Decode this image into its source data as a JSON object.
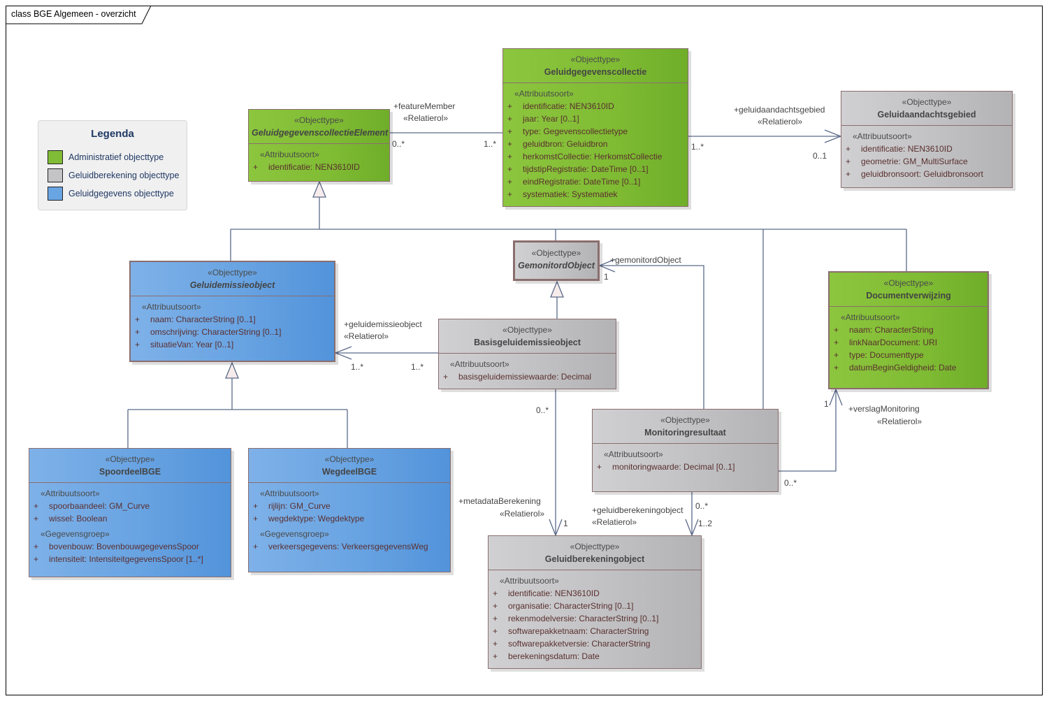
{
  "frame": {
    "title": "class BGE Algemeen - overzicht"
  },
  "colors": {
    "administratief": "#80bc35",
    "geluidberekening": "#c4c4c6",
    "geluidgegevens": "#6aa5e3",
    "connector": "#5b6a8a",
    "legend_text": "#1f3864"
  },
  "legend": {
    "title": "Legenda",
    "items": [
      {
        "label": "Administratief objecttype",
        "color": "#80bc35"
      },
      {
        "label": "Geluidberekening objecttype",
        "color": "#c4c4c6"
      },
      {
        "label": "Geluidgegevens objecttype",
        "color": "#6aa5e3"
      }
    ]
  },
  "classes": {
    "geluidgegevenscollectie": {
      "stereotype": "«Objecttype»",
      "name": "Geluidgegevenscollectie",
      "sections": [
        {
          "stereotype": "«Attribuutsoort»",
          "attributes": [
            "identificatie: NEN3610ID",
            "jaar: Year [0..1]",
            "type: Gegevenscollectietype",
            "geluidbron: Geluidbron",
            "herkomstCollectie: HerkomstCollectie",
            "tijdstipRegistratie: DateTime [0..1]",
            "eindRegistratie: DateTime [0..1]",
            "systematiek: Systematiek"
          ]
        }
      ]
    },
    "geluidgegevenscollectieElement": {
      "stereotype": "«Objecttype»",
      "name": "GeluidgegevenscollectieElement",
      "sections": [
        {
          "stereotype": "«Attribuutsoort»",
          "attributes": [
            "identificatie: NEN3610ID"
          ]
        }
      ]
    },
    "geluidaandachtsgebied": {
      "stereotype": "«Objecttype»",
      "name": "Geluidaandachtsgebied",
      "sections": [
        {
          "stereotype": "«Attribuutsoort»",
          "attributes": [
            "identificatie: NEN3610ID",
            "geometrie: GM_MultiSurface",
            "geluidbronsoort: Geluidbronsoort"
          ]
        }
      ]
    },
    "geluidemissieobject": {
      "stereotype": "«Objecttype»",
      "name": "Geluidemissieobject",
      "sections": [
        {
          "stereotype": "«Attribuutsoort»",
          "attributes": [
            "naam: CharacterString [0..1]",
            "omschrijving: CharacterString [0..1]",
            "situatieVan: Year [0..1]"
          ]
        }
      ]
    },
    "gemonitordObject": {
      "stereotype": "«Objecttype»",
      "name": "GemonitordObject"
    },
    "basisgeluidemissieobject": {
      "stereotype": "«Objecttype»",
      "name": "Basisgeluidemissieobject",
      "sections": [
        {
          "stereotype": "«Attribuutsoort»",
          "attributes": [
            "basisgeluidemissiewaarde: Decimal"
          ]
        }
      ]
    },
    "documentverwijzing": {
      "stereotype": "«Objecttype»",
      "name": "Documentverwijzing",
      "sections": [
        {
          "stereotype": "«Attribuutsoort»",
          "attributes": [
            "naam: CharacterString",
            "linkNaarDocument: URI",
            "type: Documenttype",
            "datumBeginGeldigheid: Date"
          ]
        }
      ]
    },
    "monitoringresultaat": {
      "stereotype": "«Objecttype»",
      "name": "Monitoringresultaat",
      "sections": [
        {
          "stereotype": "«Attribuutsoort»",
          "attributes": [
            "monitoringwaarde: Decimal [0..1]"
          ]
        }
      ]
    },
    "spoordeelBGE": {
      "stereotype": "«Objecttype»",
      "name": "SpoordeelBGE",
      "sections": [
        {
          "stereotype": "«Attribuutsoort»",
          "attributes": [
            "spoorbaandeel: GM_Curve",
            "wissel: Boolean"
          ]
        },
        {
          "stereotype": "«Gegevensgroep»",
          "attributes": [
            "bovenbouw: BovenbouwgegevensSpoor",
            "intensiteit: IntensiteitgegevensSpoor [1..*]"
          ]
        }
      ]
    },
    "wegdeelBGE": {
      "stereotype": "«Objecttype»",
      "name": "WegdeelBGE",
      "sections": [
        {
          "stereotype": "«Attribuutsoort»",
          "attributes": [
            "rijlijn: GM_Curve",
            "wegdektype: Wegdektype"
          ]
        },
        {
          "stereotype": "«Gegevensgroep»",
          "attributes": [
            "verkeersgegevens: VerkeersgegevensWeg"
          ]
        }
      ]
    },
    "geluidberekeningobject": {
      "stereotype": "«Objecttype»",
      "name": "Geluidberekeningobject",
      "sections": [
        {
          "stereotype": "«Attribuutsoort»",
          "attributes": [
            "identificatie: NEN3610ID",
            "organisatie: CharacterString [0..1]",
            "rekenmodelversie: CharacterString [0..1]",
            "softwarepakketnaam: CharacterString",
            "softwarepakketversie: CharacterString",
            "berekeningsdatum: Date"
          ]
        }
      ]
    }
  },
  "visibility_symbol": "+",
  "associations": {
    "featureMember": {
      "role": "+featureMember",
      "stereotype": "«Relatierol»",
      "source_mult": "0..*",
      "target_mult": "1..*"
    },
    "geluidaandachtsgebied": {
      "role": "+geluidaandachtsgebied",
      "stereotype": "«Relatierol»",
      "source_mult": "1..*",
      "target_mult": "0..1"
    },
    "geluidemissieobject": {
      "role": "+geluidemissieobject",
      "stereotype": "«Relatierol»",
      "source_mult": "1..*",
      "target_mult": "1..*"
    },
    "gemonitordObject": {
      "role": "+gemonitordObject",
      "target_mult": "1"
    },
    "verslagMonitoring": {
      "role": "+verslagMonitoring",
      "stereotype": "«Relatierol»",
      "source_mult": "0..*",
      "target_mult": "1"
    },
    "metadataBerekening": {
      "role": "+metadataBerekening",
      "stereotype": "«Relatierol»",
      "source_mult": "0..*",
      "target_mult": "1"
    },
    "geluidberekeningobject": {
      "role": "+geluidberekeningobject",
      "stereotype": "«Relatierol»",
      "source_mult": "0..*",
      "target_mult": "1..2"
    }
  }
}
